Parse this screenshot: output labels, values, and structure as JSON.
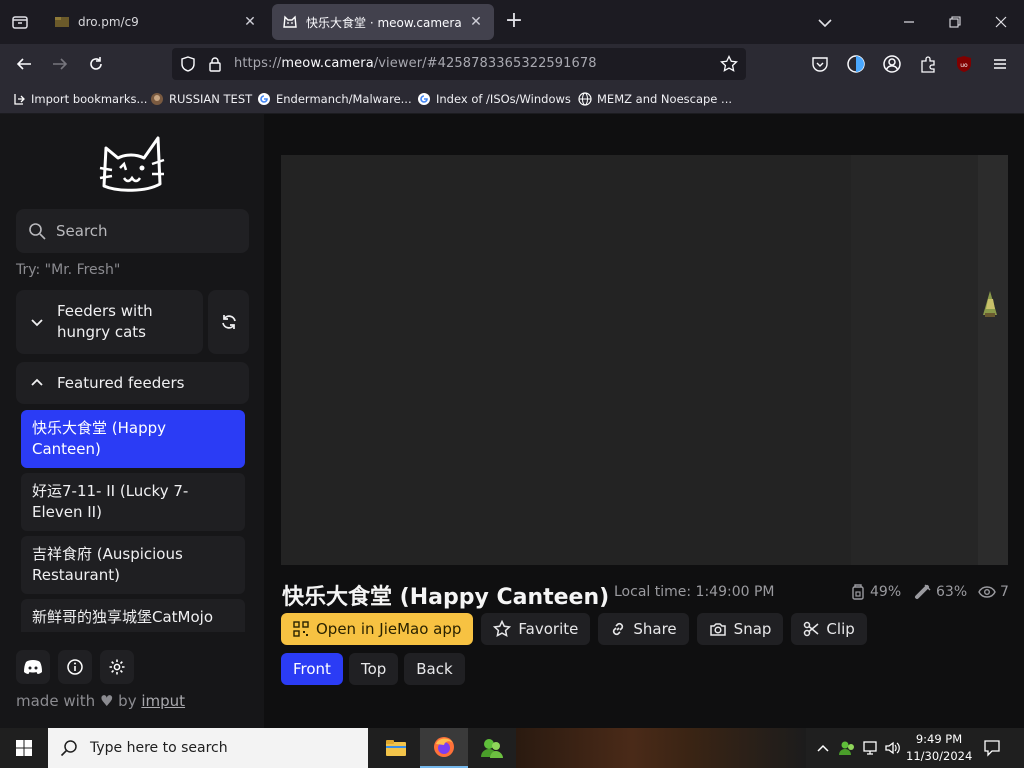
{
  "browser": {
    "tabs": [
      {
        "title": "dro.pm/c9",
        "active": false
      },
      {
        "title": "快乐大食堂 · meow.camera",
        "active": true
      }
    ],
    "url_prefix": "https://",
    "url_host": "meow.camera",
    "url_path": "/viewer/#4258783365322591678",
    "bookmarks": [
      {
        "label": "Import bookmarks...",
        "icon": "import-icon"
      },
      {
        "label": "RUSSIAN TEST",
        "icon": "bookmark-favicon"
      },
      {
        "label": "Endermanch/Malware...",
        "icon": "google-icon"
      },
      {
        "label": "Index of /ISOs/Windows",
        "icon": "google-icon"
      },
      {
        "label": "MEMZ and Noescape ...",
        "icon": "globe-icon"
      }
    ]
  },
  "sidebar": {
    "search_placeholder": "Search",
    "try_hint": "Try: \"Mr. Fresh\"",
    "hungry_section": "Feeders with hungry cats",
    "featured_section": "Featured feeders",
    "feeders": [
      {
        "label": "快乐大食堂 (Happy Canteen)",
        "selected": true
      },
      {
        "label": "好运7-11- II  (Lucky 7-Eleven II)",
        "selected": false
      },
      {
        "label": "吉祥食府 (Auspicious Restaurant)",
        "selected": false
      },
      {
        "label": "新鲜哥的独享城堡CatMojo",
        "selected": false
      }
    ],
    "footer_icons": [
      "discord-icon",
      "info-icon",
      "settings-icon"
    ],
    "made_with": "made with",
    "made_by": "by",
    "made_link": "imput"
  },
  "viewer": {
    "title": "快乐大食堂 (Happy Canteen)",
    "local_time": "Local time: 1:49:00 PM",
    "food_level": "49%",
    "battery_level": "63%",
    "viewers": "7",
    "actions": {
      "open_app": "Open in JieMao app",
      "favorite": "Favorite",
      "share": "Share",
      "snap": "Snap",
      "clip": "Clip"
    },
    "views": [
      {
        "label": "Front",
        "active": true
      },
      {
        "label": "Top",
        "active": false
      },
      {
        "label": "Back",
        "active": false
      }
    ]
  },
  "taskbar": {
    "search_placeholder": "Type here to search",
    "time": "9:49 PM",
    "date": "11/30/2024",
    "colors": {
      "accent": "#2b3cf5",
      "app_button": "#f7c242"
    }
  }
}
